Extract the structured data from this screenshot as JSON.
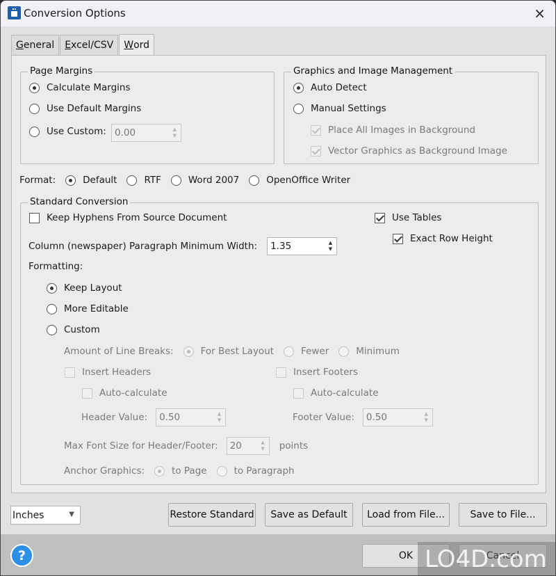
{
  "window": {
    "title": "Conversion Options",
    "close_icon": "×"
  },
  "tabs": [
    {
      "label": "General",
      "underline": "G",
      "rest": "eneral"
    },
    {
      "label": "Excel/CSV",
      "underline": "E",
      "rest": "xcel/CSV"
    },
    {
      "label": "Word",
      "underline": "W",
      "rest": "ord",
      "active": true
    }
  ],
  "page_margins": {
    "title": "Page Margins",
    "options": [
      "Calculate Margins",
      "Use Default Margins",
      "Use Custom:"
    ],
    "selected": 0,
    "custom_value": "0.00"
  },
  "graphics": {
    "title": "Graphics and Image Management",
    "options": [
      "Auto Detect",
      "Manual Settings"
    ],
    "selected": 0,
    "sub_options": [
      {
        "label": "Place All Images in Background",
        "checked": true,
        "disabled": true
      },
      {
        "label": "Vector Graphics as Background Image",
        "checked": true,
        "disabled": true
      }
    ]
  },
  "format": {
    "label": "Format:",
    "options": [
      "Default",
      "RTF",
      "Word 2007",
      "OpenOffice Writer"
    ],
    "selected": 0
  },
  "standard_conversion": {
    "title": "Standard Conversion",
    "keep_hyphens": {
      "label": "Keep Hyphens From Source Document",
      "checked": false
    },
    "use_tables": {
      "label": "Use Tables",
      "checked": true
    },
    "exact_row_height": {
      "label": "Exact Row Height",
      "checked": true
    },
    "column_width": {
      "label": "Column (newspaper) Paragraph Minimum Width:",
      "value": "1.35"
    },
    "formatting_label": "Formatting:",
    "formatting_options": [
      "Keep Layout",
      "More Editable",
      "Custom"
    ],
    "formatting_selected": 0,
    "line_breaks": {
      "label": "Amount of Line Breaks:",
      "options": [
        "For Best Layout",
        "Fewer",
        "Minimum"
      ],
      "selected": 0
    },
    "insert_headers": {
      "label": "Insert Headers",
      "checked": false
    },
    "insert_footers": {
      "label": "Insert Footers",
      "checked": false
    },
    "header_auto": {
      "label": "Auto-calculate",
      "checked": false
    },
    "footer_auto": {
      "label": "Auto-calculate",
      "checked": false
    },
    "header_value": {
      "label": "Header Value:",
      "value": "0.50"
    },
    "footer_value": {
      "label": "Footer Value:",
      "value": "0.50"
    },
    "max_font": {
      "label": "Max Font Size for Header/Footer:",
      "value": "20",
      "unit": "points"
    },
    "anchor": {
      "label": "Anchor Graphics:",
      "options": [
        "to Page",
        "to Paragraph"
      ],
      "selected": 0
    }
  },
  "units": {
    "selected": "Inches"
  },
  "buttons": {
    "restore": "Restore Standard",
    "save_default": "Save as Default",
    "load": "Load from File...",
    "save_file": "Save to File...",
    "ok": "OK",
    "cancel": "Cancel",
    "help": "?"
  },
  "watermark": "LO4D.com"
}
